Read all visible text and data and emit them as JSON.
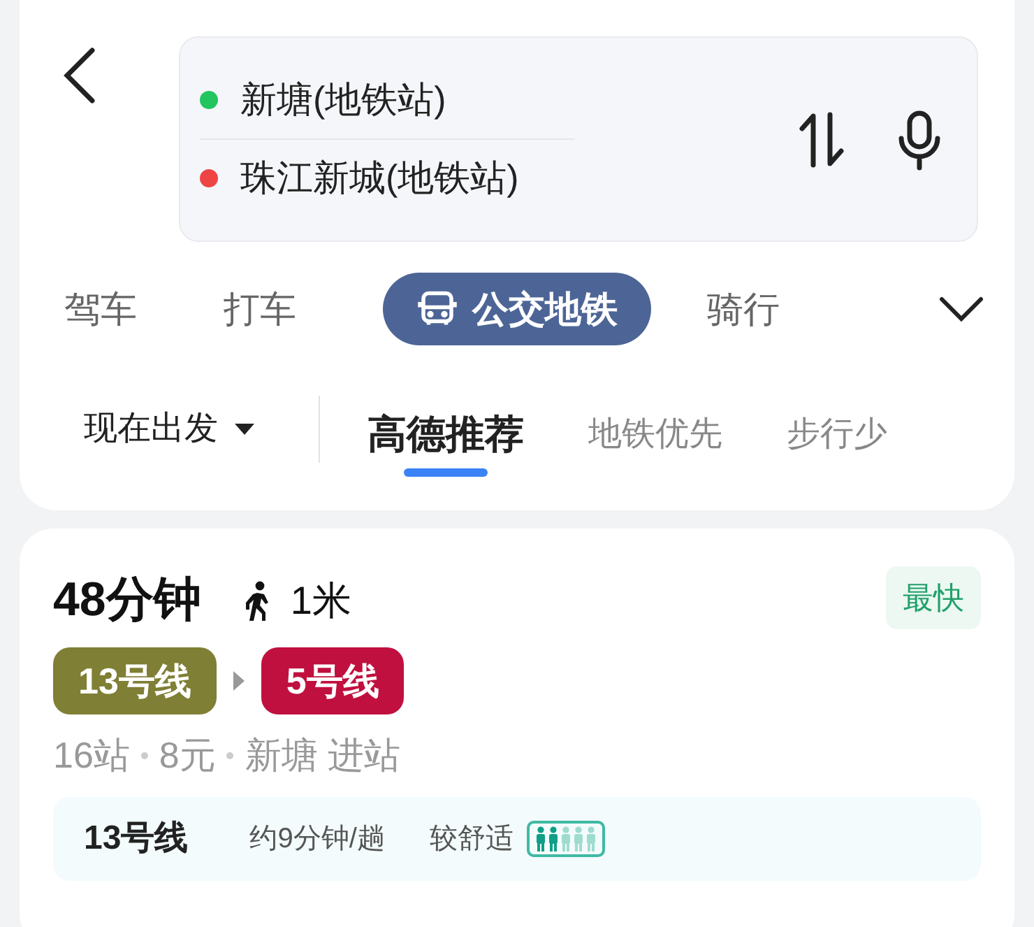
{
  "stops": [
    {
      "name": "新塘(地铁站)",
      "color": "#22c55e"
    },
    {
      "name": "珠江新城(地铁站)",
      "color": "#ef4444"
    }
  ],
  "modes": [
    {
      "label": "驾车",
      "selected": false,
      "kind": "text"
    },
    {
      "label": "打车",
      "selected": false,
      "kind": "text"
    },
    {
      "label": "公交地铁",
      "selected": true,
      "kind": "bus"
    },
    {
      "label": "骑行",
      "selected": false,
      "kind": "text"
    }
  ],
  "depart": {
    "label": "现在出发"
  },
  "sorts": [
    {
      "label": "高德推荐",
      "selected": true
    },
    {
      "label": "地铁优先",
      "selected": false
    },
    {
      "label": "步行少",
      "selected": false
    }
  ],
  "route": {
    "duration": "48分钟",
    "walk": "1米",
    "badge": "最快",
    "lines": [
      {
        "label": "13号线",
        "color": "#7f7f35"
      },
      {
        "label": "5号线",
        "color": "#c0103f"
      }
    ],
    "info": [
      "16站",
      "8元",
      "新塘 进站"
    ],
    "detail": {
      "line": "13号线",
      "interval": "约9分钟/趟",
      "comfort": "较舒适"
    }
  }
}
